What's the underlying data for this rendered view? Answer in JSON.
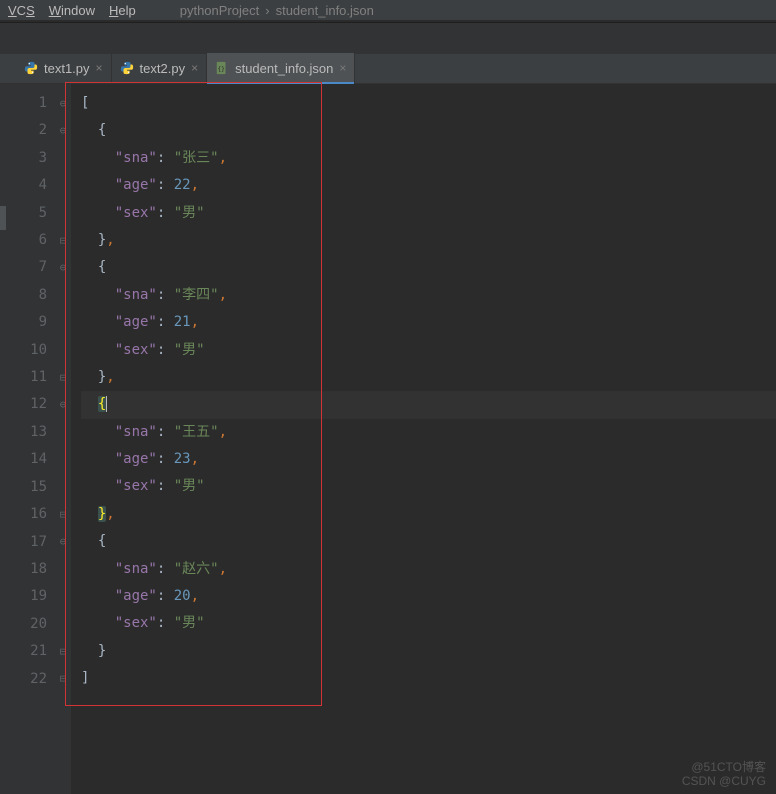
{
  "menu": {
    "vcs": "VCS",
    "window": "Window",
    "help": "Help"
  },
  "breadcrumb": {
    "project": "pythonProject",
    "sep": "›",
    "file": "student_info.json"
  },
  "tabs": [
    {
      "label": "text1.py",
      "type": "py",
      "active": false
    },
    {
      "label": "text2.py",
      "type": "py",
      "active": false
    },
    {
      "label": "student_info.json",
      "type": "json",
      "active": true
    }
  ],
  "editor": {
    "current_line": 12,
    "lines": [
      {
        "n": 1,
        "tokens": [
          {
            "t": "[",
            "c": "brace"
          }
        ]
      },
      {
        "n": 2,
        "tokens": [
          {
            "t": "  {",
            "c": "brace"
          }
        ]
      },
      {
        "n": 3,
        "tokens": [
          {
            "t": "    ",
            "c": "brace"
          },
          {
            "t": "\"sna\"",
            "c": "key"
          },
          {
            "t": ": ",
            "c": "brace"
          },
          {
            "t": "\"张三\"",
            "c": "str"
          },
          {
            "t": ",",
            "c": "punc"
          }
        ]
      },
      {
        "n": 4,
        "tokens": [
          {
            "t": "    ",
            "c": "brace"
          },
          {
            "t": "\"age\"",
            "c": "key"
          },
          {
            "t": ": ",
            "c": "brace"
          },
          {
            "t": "22",
            "c": "num"
          },
          {
            "t": ",",
            "c": "punc"
          }
        ]
      },
      {
        "n": 5,
        "tokens": [
          {
            "t": "    ",
            "c": "brace"
          },
          {
            "t": "\"sex\"",
            "c": "key"
          },
          {
            "t": ": ",
            "c": "brace"
          },
          {
            "t": "\"男\"",
            "c": "str"
          }
        ]
      },
      {
        "n": 6,
        "tokens": [
          {
            "t": "  }",
            "c": "brace"
          },
          {
            "t": ",",
            "c": "punc"
          }
        ]
      },
      {
        "n": 7,
        "tokens": [
          {
            "t": "  {",
            "c": "brace"
          }
        ]
      },
      {
        "n": 8,
        "tokens": [
          {
            "t": "    ",
            "c": "brace"
          },
          {
            "t": "\"sna\"",
            "c": "key"
          },
          {
            "t": ": ",
            "c": "brace"
          },
          {
            "t": "\"李四\"",
            "c": "str"
          },
          {
            "t": ",",
            "c": "punc"
          }
        ]
      },
      {
        "n": 9,
        "tokens": [
          {
            "t": "    ",
            "c": "brace"
          },
          {
            "t": "\"age\"",
            "c": "key"
          },
          {
            "t": ": ",
            "c": "brace"
          },
          {
            "t": "21",
            "c": "num"
          },
          {
            "t": ",",
            "c": "punc"
          }
        ]
      },
      {
        "n": 10,
        "tokens": [
          {
            "t": "    ",
            "c": "brace"
          },
          {
            "t": "\"sex\"",
            "c": "key"
          },
          {
            "t": ": ",
            "c": "brace"
          },
          {
            "t": "\"男\"",
            "c": "str"
          }
        ]
      },
      {
        "n": 11,
        "tokens": [
          {
            "t": "  }",
            "c": "brace"
          },
          {
            "t": ",",
            "c": "punc"
          }
        ]
      },
      {
        "n": 12,
        "tokens": [
          {
            "t": "  ",
            "c": "brace"
          },
          {
            "t": "{",
            "c": "hl"
          }
        ]
      },
      {
        "n": 13,
        "tokens": [
          {
            "t": "    ",
            "c": "brace"
          },
          {
            "t": "\"sna\"",
            "c": "key"
          },
          {
            "t": ": ",
            "c": "brace"
          },
          {
            "t": "\"王五\"",
            "c": "str"
          },
          {
            "t": ",",
            "c": "punc"
          }
        ]
      },
      {
        "n": 14,
        "tokens": [
          {
            "t": "    ",
            "c": "brace"
          },
          {
            "t": "\"age\"",
            "c": "key"
          },
          {
            "t": ": ",
            "c": "brace"
          },
          {
            "t": "23",
            "c": "num"
          },
          {
            "t": ",",
            "c": "punc"
          }
        ]
      },
      {
        "n": 15,
        "tokens": [
          {
            "t": "    ",
            "c": "brace"
          },
          {
            "t": "\"sex\"",
            "c": "key"
          },
          {
            "t": ": ",
            "c": "brace"
          },
          {
            "t": "\"男\"",
            "c": "str"
          }
        ]
      },
      {
        "n": 16,
        "tokens": [
          {
            "t": "  ",
            "c": "brace"
          },
          {
            "t": "}",
            "c": "hl"
          },
          {
            "t": ",",
            "c": "punc"
          }
        ]
      },
      {
        "n": 17,
        "tokens": [
          {
            "t": "  {",
            "c": "brace"
          }
        ]
      },
      {
        "n": 18,
        "tokens": [
          {
            "t": "    ",
            "c": "brace"
          },
          {
            "t": "\"sna\"",
            "c": "key"
          },
          {
            "t": ": ",
            "c": "brace"
          },
          {
            "t": "\"赵六\"",
            "c": "str"
          },
          {
            "t": ",",
            "c": "punc"
          }
        ]
      },
      {
        "n": 19,
        "tokens": [
          {
            "t": "    ",
            "c": "brace"
          },
          {
            "t": "\"age\"",
            "c": "key"
          },
          {
            "t": ": ",
            "c": "brace"
          },
          {
            "t": "20",
            "c": "num"
          },
          {
            "t": ",",
            "c": "punc"
          }
        ]
      },
      {
        "n": 20,
        "tokens": [
          {
            "t": "    ",
            "c": "brace"
          },
          {
            "t": "\"sex\"",
            "c": "key"
          },
          {
            "t": ": ",
            "c": "brace"
          },
          {
            "t": "\"男\"",
            "c": "str"
          }
        ]
      },
      {
        "n": 21,
        "tokens": [
          {
            "t": "  }",
            "c": "brace"
          }
        ]
      },
      {
        "n": 22,
        "tokens": [
          {
            "t": "]",
            "c": "brace"
          }
        ]
      }
    ],
    "fold_rows": [
      1,
      2,
      6,
      7,
      11,
      12,
      16,
      17,
      21,
      22
    ]
  },
  "watermark": {
    "line1": "@51CTO博客",
    "line2": "CSDN @CUYG"
  }
}
